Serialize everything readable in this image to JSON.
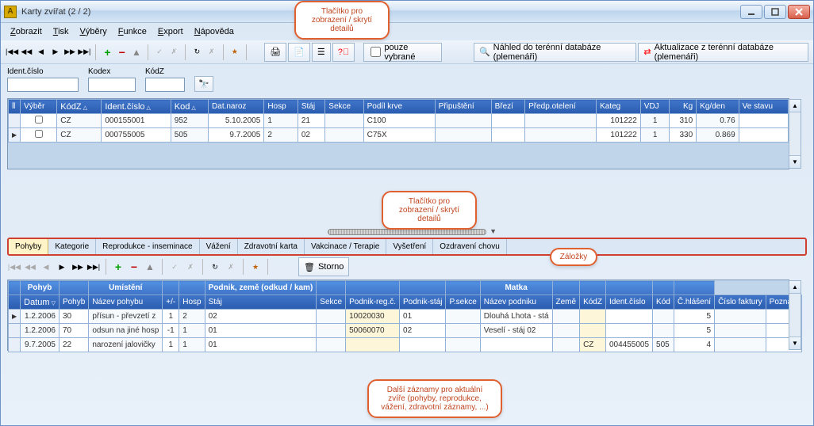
{
  "window": {
    "title": "Karty zvířat (2 / 2)"
  },
  "menu": [
    "Zobrazit",
    "Tisk",
    "Výběry",
    "Funkce",
    "Export",
    "Nápověda"
  ],
  "toolbar": {
    "only_selected": "pouze vybrané",
    "btn_terrain_view": "Náhled do terénní databáze (plemenáři)",
    "btn_terrain_update": "Aktualizace z terénní databáze (plemenáři)"
  },
  "filter_labels": {
    "ident": "Ident.číslo",
    "kodex": "Kodex",
    "kodz": "KódZ"
  },
  "callouts": {
    "c1": "Tlačítko pro zobrazení / skrytí detailů",
    "c2": "Tlačítko pro zobrazení / skrytí detailů",
    "c3": "Záložky",
    "c4": "Další záznamy pro aktuální zvíře (pohyby, reprodukce, vážení, zdravotní záznamy, ...)"
  },
  "main_grid": {
    "headers": [
      "Výběr",
      "KódZ",
      "Ident.číslo",
      "Kod",
      "Dat.naroz",
      "Hosp",
      "Stáj",
      "Sekce",
      "Podíl krve",
      "Připuštění",
      "Březí",
      "Předp.otelení",
      "Kateg",
      "VDJ",
      "Kg",
      "Kg/den",
      "Ve stavu"
    ],
    "rows": [
      {
        "ind": "",
        "vyber": "",
        "kodz": "CZ",
        "ident": "000155001",
        "kod": "952",
        "datnaroz": "5.10.2005",
        "hosp": "1",
        "staj": "21",
        "sekce": "",
        "podil": "C100",
        "prip": "",
        "brezi": "",
        "predp": "",
        "kateg": "101222",
        "vdj": "1",
        "kg": "310",
        "kgden": "0.76",
        "vest": ""
      },
      {
        "ind": "▶",
        "vyber": "",
        "kodz": "CZ",
        "ident": "000755005",
        "kod": "505",
        "datnaroz": "9.7.2005",
        "hosp": "2",
        "staj": "02",
        "sekce": "",
        "podil": "C75X",
        "prip": "",
        "brezi": "",
        "predp": "",
        "kateg": "101222",
        "vdj": "1",
        "kg": "330",
        "kgden": "0.869",
        "vest": ""
      }
    ]
  },
  "tabs": [
    "Pohyby",
    "Kategorie",
    "Reprodukce - inseminace",
    "Vážení",
    "Zdravotní karta",
    "Vakcinace / Terapie",
    "Vyšetření",
    "Ozdravení chovu"
  ],
  "tabs_active": 0,
  "storno_btn": "Storno",
  "detail_grid": {
    "groups": {
      "pohyb": "Pohyb",
      "umisteni": "Umístění",
      "podnik": "Podnik, země (odkud / kam)",
      "matka": "Matka",
      "ch": "",
      "cf": "",
      "pz": ""
    },
    "headers": [
      "Datum",
      "Pohyb",
      "Název pohybu",
      "+/-",
      "Hosp",
      "Stáj",
      "Sekce",
      "Podnik-reg.č.",
      "Podnik-stáj",
      "P.sekce",
      "Název podniku",
      "Země",
      "KódZ",
      "Ident.číslo",
      "Kód",
      "Č.hlášení",
      "Číslo faktury",
      "Poznám"
    ],
    "rows": [
      {
        "ind": "▶",
        "datum": "1.2.2006",
        "pohyb": "30",
        "nazev": "přísun - převzetí z",
        "pm": "1",
        "hosp": "2",
        "staj": "02",
        "sekce": "",
        "preg": "10020030",
        "pstaj": "01",
        "psekce": "",
        "npod": "Dlouhá Lhota - stá",
        "zeme": "",
        "kodz": "",
        "ident": "",
        "kod": "",
        "ch": "5",
        "cf": "",
        "pz": ""
      },
      {
        "ind": "",
        "datum": "1.2.2006",
        "pohyb": "70",
        "nazev": "odsun na jiné hosp",
        "pm": "-1",
        "hosp": "1",
        "staj": "01",
        "sekce": "",
        "preg": "50060070",
        "pstaj": "02",
        "psekce": "",
        "npod": "Veselí - stáj 02",
        "zeme": "",
        "kodz": "",
        "ident": "",
        "kod": "",
        "ch": "5",
        "cf": "",
        "pz": ""
      },
      {
        "ind": "",
        "datum": "9.7.2005",
        "pohyb": "22",
        "nazev": "narození jalovičky",
        "pm": "1",
        "hosp": "1",
        "staj": "01",
        "sekce": "",
        "preg": "",
        "pstaj": "",
        "psekce": "",
        "npod": "",
        "zeme": "",
        "kodz": "CZ",
        "ident": "004455005",
        "kod": "505",
        "ch": "4",
        "cf": "",
        "pz": ""
      }
    ]
  }
}
